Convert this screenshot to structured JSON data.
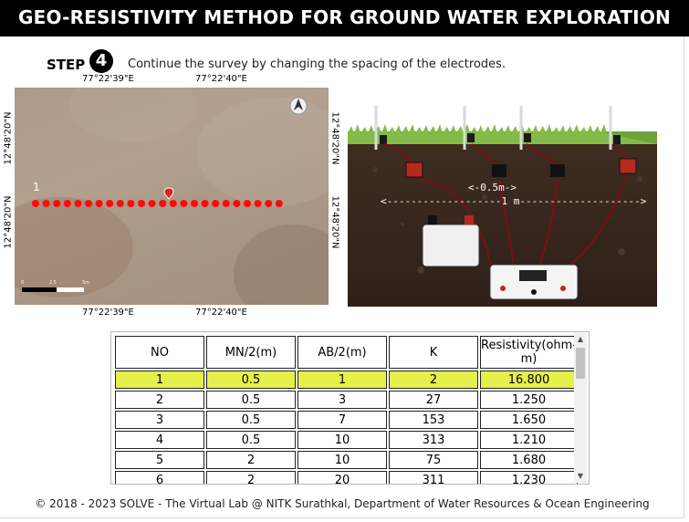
{
  "page": {
    "title": "GEO-RESISTIVITY METHOD FOR GROUND WATER EXPLORATION"
  },
  "step": {
    "label": "STEP",
    "number": "4",
    "instruction": "Continue the survey by changing the spacing of the electrodes."
  },
  "map": {
    "coords": {
      "top_left": "77°22'39\"E",
      "top_right": "77°22'40\"E",
      "bottom_left": "77°22'39\"E",
      "bottom_right": "77°22'40\"E",
      "left_top": "12°48'20\"N",
      "left_bottom": "12°48'20\"N",
      "right_top": "12°48'20\"N",
      "right_bottom": "12°48'20\"N"
    },
    "point_label": "1",
    "scale_labels": [
      "0",
      "2.5",
      "5m"
    ],
    "electrode_points": 24,
    "icons": [
      "north-arrow-icon",
      "location-pin-icon"
    ]
  },
  "diagram": {
    "label_inner": "<-0.5m->",
    "label_outer": "<-------------------1 m-------------------->"
  },
  "table": {
    "headers": [
      "NO",
      "MN/2(m)",
      "AB/2(m)",
      "K",
      "Resistivity(ohm-m)"
    ],
    "rows": [
      [
        "1",
        "0.5",
        "1",
        "2",
        "16.800"
      ],
      [
        "2",
        "0.5",
        "3",
        "27",
        "1.250"
      ],
      [
        "3",
        "0.5",
        "7",
        "153",
        "1.650"
      ],
      [
        "4",
        "0.5",
        "10",
        "313",
        "1.210"
      ],
      [
        "5",
        "2",
        "10",
        "75",
        "1.680"
      ],
      [
        "6",
        "2",
        "20",
        "311",
        "1.230"
      ]
    ],
    "highlight_row": 0,
    "highlight_color": "#e5f04a"
  },
  "footer": {
    "text": "© 2018 - 2023 SOLVE - The Virtual Lab @ NITK Surathkal, Department of Water Resources & Ocean Engineering"
  }
}
